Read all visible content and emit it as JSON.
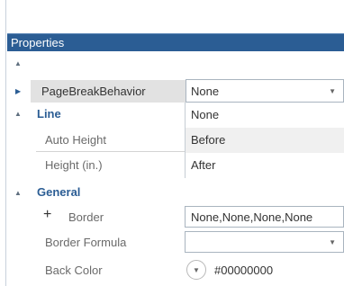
{
  "panel": {
    "title": "Properties"
  },
  "rows": {
    "page_break": {
      "label": "PageBreakBehavior",
      "value": "None"
    },
    "line_category": {
      "label": "Line"
    },
    "auto_height": {
      "label": "Auto Height"
    },
    "height": {
      "label": "Height (in.)"
    },
    "general_category": {
      "label": "General"
    },
    "border": {
      "label": "Border",
      "value": "None,None,None,None"
    },
    "border_formula": {
      "label": "Border Formula",
      "value": ""
    },
    "back_color": {
      "label": "Back Color",
      "value": "#00000000"
    }
  },
  "dropdown_options": [
    "None",
    "Before",
    "After"
  ],
  "icons": {
    "collapse": "▲",
    "expand": "▶",
    "chevron": "▼",
    "plus": "+"
  },
  "colors": {
    "header_bg": "#2b5d94",
    "category_text": "#2b5d94",
    "selected_label_bg": "#e2e2e2",
    "hover_option_bg": "#f0f0f0"
  }
}
